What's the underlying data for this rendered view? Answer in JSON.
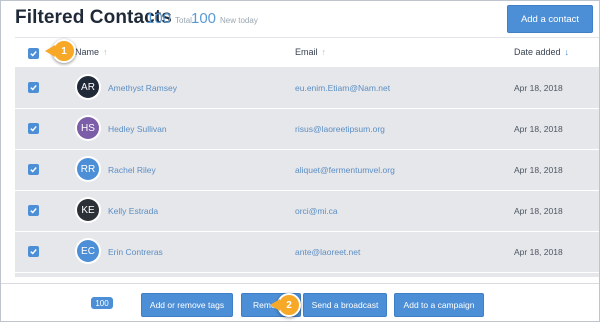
{
  "header": {
    "title": "Filtered Contacts",
    "total_count": "100",
    "total_label": "Total",
    "new_count": "100",
    "new_label": "New today",
    "add_contact_label": "Add a contact"
  },
  "table": {
    "columns": {
      "name": "Name",
      "email": "Email",
      "date_added": "Date added"
    },
    "rows": [
      {
        "initials": "AR",
        "avatar_color": "#1f2937",
        "name": "Amethyst Ramsey",
        "email": "eu.enim.Etiam@Nam.net",
        "date": "Apr 18, 2018"
      },
      {
        "initials": "HS",
        "avatar_color": "#7b5ea7",
        "name": "Hedley Sullivan",
        "email": "risus@laoreetipsum.org",
        "date": "Apr 18, 2018"
      },
      {
        "initials": "RR",
        "avatar_color": "#4d8fd6",
        "name": "Rachel Riley",
        "email": "aliquet@fermentumvel.org",
        "date": "Apr 18, 2018"
      },
      {
        "initials": "KE",
        "avatar_color": "#2b2f36",
        "name": "Kelly Estrada",
        "email": "orci@mi.ca",
        "date": "Apr 18, 2018"
      },
      {
        "initials": "EC",
        "avatar_color": "#4d8fd6",
        "name": "Erin Contreras",
        "email": "ante@laoreet.net",
        "date": "Apr 18, 2018"
      }
    ]
  },
  "footer": {
    "selected_count": "100",
    "add_remove_tags": "Add or remove tags",
    "remove_partial": "Remo",
    "send_broadcast": "Send a broadcast",
    "add_campaign": "Add to a campaign"
  },
  "callouts": {
    "one": "1",
    "two": "2"
  },
  "colors": {
    "accent": "#4d8fd6",
    "callout": "#f6a826",
    "row_selected": "#e6e7ea"
  }
}
